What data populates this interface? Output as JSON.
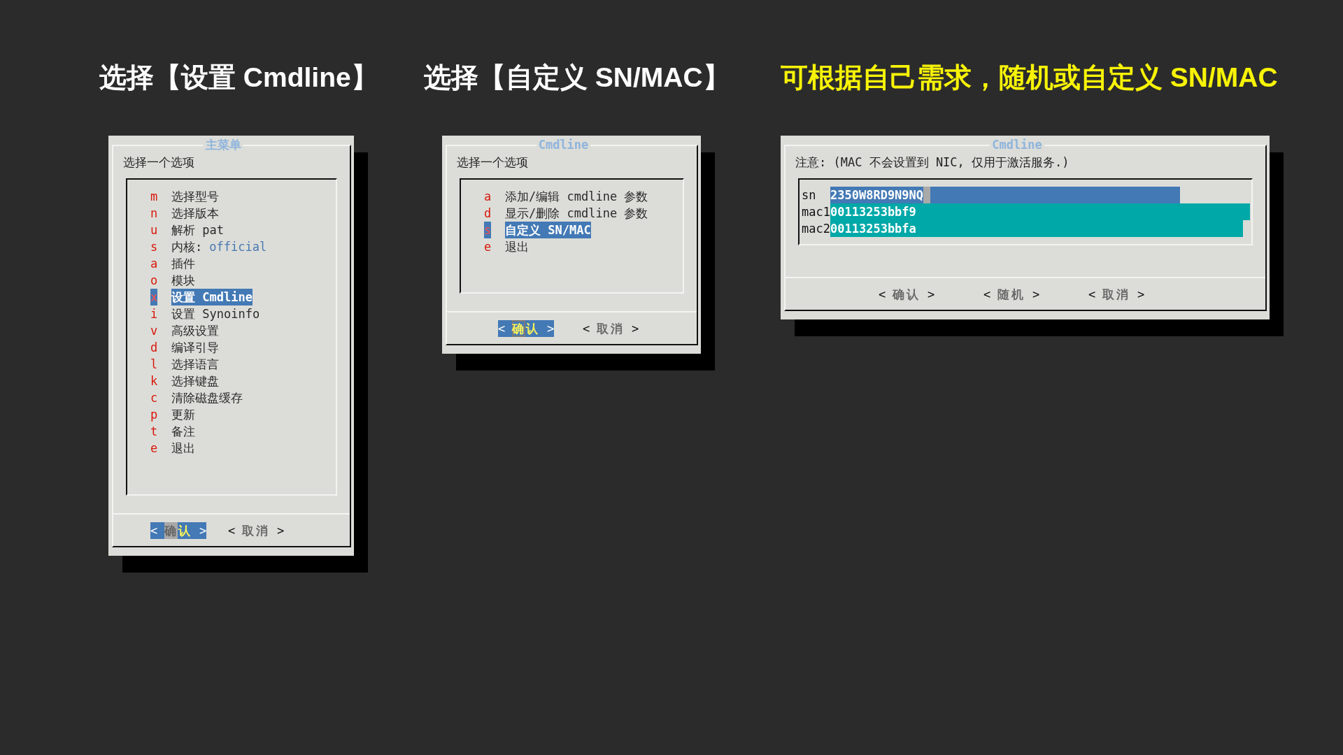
{
  "steps": [
    {
      "heading": {
        "text": "选择【设置 Cmdline】",
        "highlighted": false
      },
      "dialog": {
        "kind": "menu",
        "title": "主菜单",
        "focused": true,
        "prompt": "选择一个选项",
        "items": [
          {
            "key": "m",
            "label": "选择型号",
            "selected": false
          },
          {
            "key": "n",
            "label": "选择版本",
            "selected": false
          },
          {
            "key": "u",
            "label": "解析 pat",
            "selected": false
          },
          {
            "key": "s",
            "label": "内核:",
            "value": "official",
            "selected": false
          },
          {
            "key": "a",
            "label": "插件",
            "selected": false
          },
          {
            "key": "o",
            "label": "模块",
            "selected": false
          },
          {
            "key": "x",
            "label": "设置 Cmdline",
            "selected": true
          },
          {
            "key": "i",
            "label": "设置 Synoinfo",
            "selected": false
          },
          {
            "key": "v",
            "label": "高级设置",
            "selected": false
          },
          {
            "key": "d",
            "label": "编译引导",
            "selected": false
          },
          {
            "key": "l",
            "label": "选择语言",
            "selected": false
          },
          {
            "key": "k",
            "label": "选择键盘",
            "selected": false
          },
          {
            "key": "c",
            "label": "清除磁盘缓存",
            "selected": false
          },
          {
            "key": "p",
            "label": "更新",
            "selected": false
          },
          {
            "key": "t",
            "label": "备注",
            "selected": false
          },
          {
            "key": "e",
            "label": "退出",
            "selected": false
          }
        ],
        "buttons": [
          {
            "prefix": "<",
            "label": "确认",
            "suffix": ">",
            "selected": true,
            "cursor": true
          },
          {
            "prefix": "<",
            "label": "取消",
            "suffix": ">",
            "selected": false,
            "cursor": false
          }
        ]
      }
    },
    {
      "heading": {
        "text": "选择【自定义 SN/MAC】",
        "highlighted": false
      },
      "dialog": {
        "kind": "menu",
        "title": "Cmdline",
        "focused": false,
        "prompt": "选择一个选项",
        "items": [
          {
            "key": "a",
            "label": "添加/编辑 cmdline 参数",
            "selected": false
          },
          {
            "key": "d",
            "label": "显示/删除 cmdline 参数",
            "selected": false
          },
          {
            "key": "s",
            "label": "自定义 SN/MAC",
            "selected": true
          },
          {
            "key": "e",
            "label": "退出",
            "selected": false
          }
        ],
        "buttons": [
          {
            "prefix": "<",
            "label": "确认",
            "suffix": ">",
            "selected": true,
            "cursor": true
          },
          {
            "prefix": "<",
            "label": "取消",
            "suffix": ">",
            "selected": false,
            "cursor": false
          }
        ]
      }
    },
    {
      "heading": {
        "text": "可根据自己需求，随机或自定义 SN/MAC",
        "highlighted": true
      },
      "dialog": {
        "kind": "form",
        "title": "Cmdline",
        "focused": true,
        "prompt": "注意: (MAC 不会设置到 NIC, 仅用于激活服务.)",
        "fields": [
          {
            "label": "sn",
            "value": "2350W8RD9N9NQ",
            "selected": true,
            "cursor": true
          },
          {
            "label": "mac1",
            "value": "00113253bbf9",
            "selected": false,
            "cursor": false
          },
          {
            "label": "mac2",
            "value": "00113253bbfa",
            "selected": false,
            "cursor": false
          }
        ],
        "buttons": [
          {
            "prefix": "<",
            "label": "确认",
            "suffix": ">",
            "selected": false,
            "cursor": false
          },
          {
            "prefix": "<",
            "label": "随机",
            "suffix": ">",
            "selected": false,
            "cursor": false
          },
          {
            "prefix": "<",
            "label": "取消",
            "suffix": ">",
            "selected": false,
            "cursor": false
          }
        ]
      }
    }
  ]
}
